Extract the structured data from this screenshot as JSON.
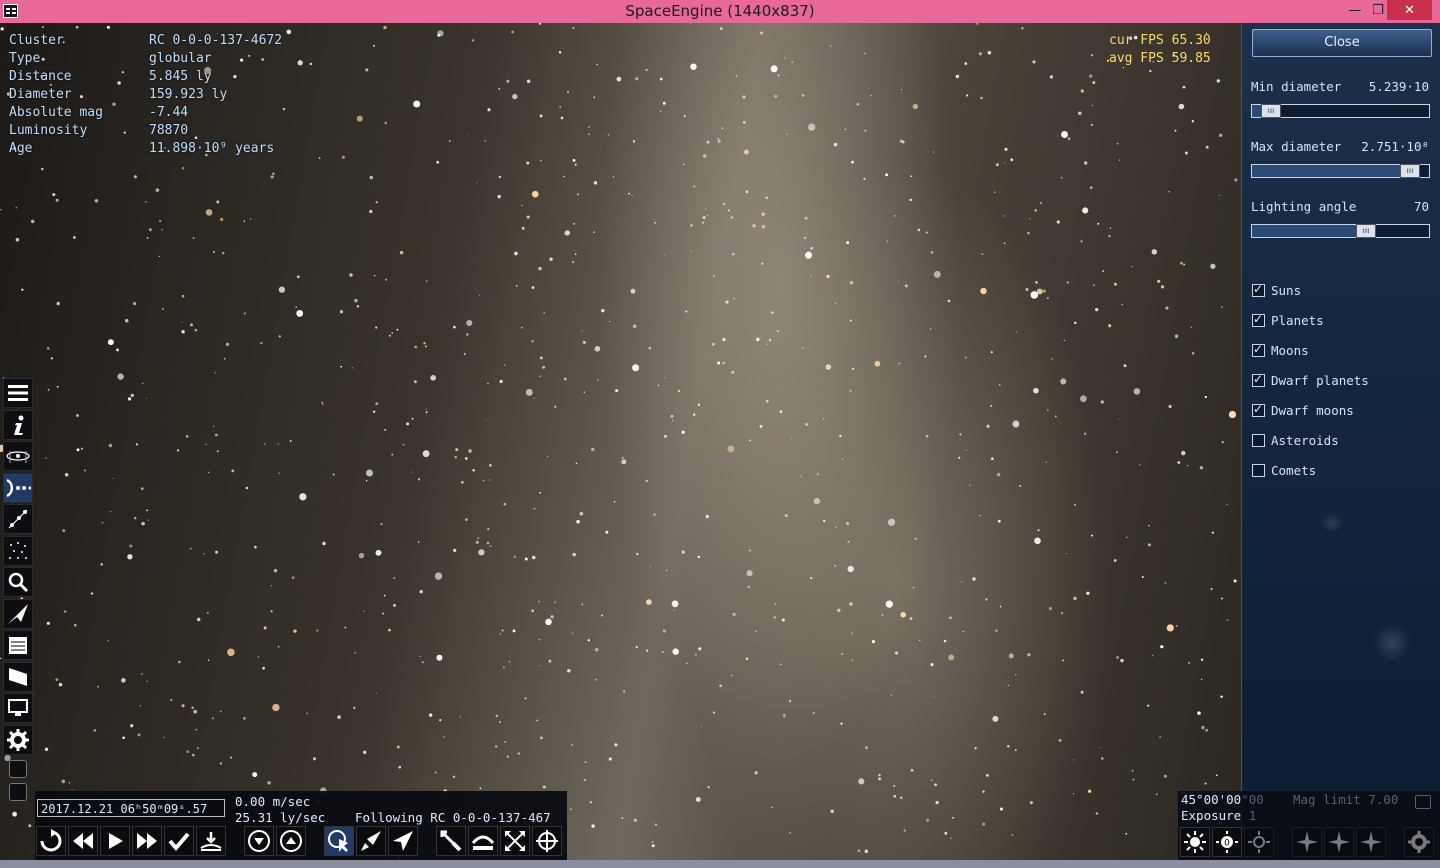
{
  "window": {
    "title": "SpaceEngine (1440x837)",
    "minimize": "—",
    "restore": "❐",
    "close": "✕"
  },
  "info": [
    {
      "key": "Cluster",
      "value": "RC 0-0-0-137-4672"
    },
    {
      "key": "Type",
      "value": "globular"
    },
    {
      "key": "Distance",
      "value": "5.845 ly"
    },
    {
      "key": "Diameter",
      "value": "159.923 ly"
    },
    {
      "key": "Absolute mag",
      "value": "-7.44"
    },
    {
      "key": "Luminosity",
      "value": "78870"
    },
    {
      "key": "Age",
      "value": "11.898·10⁹ years"
    }
  ],
  "fps": {
    "cur": "cur FPS 65.30",
    "avg": "avg FPS 59.85"
  },
  "bottom": {
    "date": "2017.12.21 06ʰ50ᵐ09ˢ.57",
    "speed1": "0.00  m/sec",
    "speed2": "25.31 ly/sec",
    "following": "Following  RC 0-0-0-137-467"
  },
  "right_panel": {
    "close_label": "Close",
    "min_diameter_label": "Min diameter",
    "min_diameter_value": "5.239·10",
    "min_diameter_fraction": 0.06,
    "max_diameter_label": "Max diameter",
    "max_diameter_value": "2.751·10⁸",
    "max_diameter_fraction": 0.94,
    "lighting_label": "Lighting angle",
    "lighting_value": "70",
    "lighting_fraction": 0.66,
    "checkboxes": [
      {
        "label": "Suns",
        "checked": true
      },
      {
        "label": "Planets",
        "checked": true
      },
      {
        "label": "Moons",
        "checked": true
      },
      {
        "label": "Dwarf planets",
        "checked": true
      },
      {
        "label": "Dwarf moons",
        "checked": true
      },
      {
        "label": "Asteroids",
        "checked": false
      },
      {
        "label": "Comets",
        "checked": false
      }
    ]
  },
  "bottom_right": {
    "angle": "45°00'00",
    "angle_dim": "\"00",
    "exposure": "Exposure",
    "exposure_dim": "1",
    "mag_limit": "Mag limit  7.00"
  },
  "left_toolbar_icons": [
    "menu-icon",
    "info-icon",
    "galaxy-icon",
    "navigation-icon",
    "tracks-icon",
    "star-map-icon",
    "search-icon",
    "ship-icon",
    "journal-icon",
    "flag-icon",
    "display-icon",
    "settings-icon"
  ],
  "colors": {
    "titlebar": "#e8689a",
    "info_text": "#bfe0ff",
    "fps_text": "#ffd86a",
    "panel_bg": "#14253e"
  }
}
